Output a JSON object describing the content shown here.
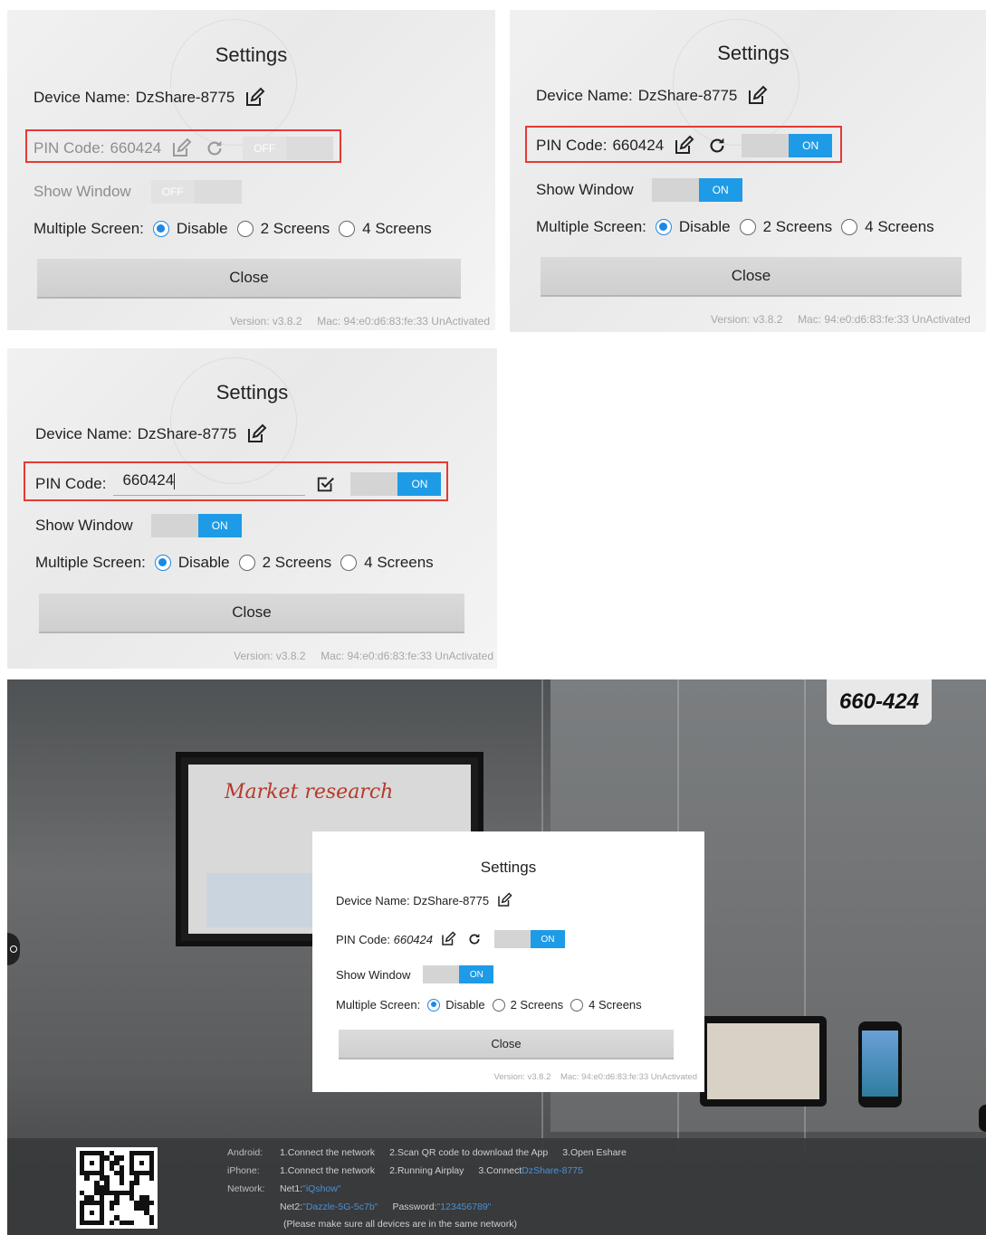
{
  "panels": [
    {
      "title": "Settings",
      "device_name_label": "Device Name:",
      "device_name_value": "DzShare-8775",
      "pin_label": "PIN Code:",
      "pin_value": "660424",
      "pin_toggle": "OFF",
      "show_window_label": "Show Window",
      "show_window_toggle": "OFF",
      "multiple_screen_label": "Multiple Screen:",
      "options": [
        "Disable",
        "2 Screens",
        "4 Screens"
      ],
      "selected": "Disable",
      "close_label": "Close",
      "version": "Version: v3.8.2",
      "mac": "Mac: 94:e0:d6:83:fe:33 UnActivated"
    },
    {
      "title": "Settings",
      "device_name_label": "Device Name:",
      "device_name_value": "DzShare-8775",
      "pin_label": "PIN Code:",
      "pin_value": "660424",
      "pin_toggle": "ON",
      "show_window_label": "Show Window",
      "show_window_toggle": "ON",
      "multiple_screen_label": "Multiple Screen:",
      "options": [
        "Disable",
        "2 Screens",
        "4 Screens"
      ],
      "selected": "Disable",
      "close_label": "Close",
      "version": "Version: v3.8.2",
      "mac": "Mac: 94:e0:d6:83:fe:33 UnActivated"
    },
    {
      "title": "Settings",
      "device_name_label": "Device Name:",
      "device_name_value": "DzShare-8775",
      "pin_label": "PIN Code:",
      "pin_value": "660424",
      "pin_toggle": "ON",
      "show_window_label": "Show Window",
      "show_window_toggle": "ON",
      "multiple_screen_label": "Multiple Screen:",
      "options": [
        "Disable",
        "2 Screens",
        "4 Screens"
      ],
      "selected": "Disable",
      "close_label": "Close",
      "version": "Version: v3.8.2",
      "mac": "Mac: 94:e0:d6:83:fe:33 UnActivated"
    }
  ],
  "fullscreen": {
    "pin_badge": "660-424",
    "board_handwriting": "Market research",
    "dialog": {
      "title": "Settings",
      "device_name_label": "Device Name:",
      "device_name_value": "DzShare-8775",
      "pin_label": "PIN Code:",
      "pin_value": "660424",
      "pin_toggle": "ON",
      "show_window_label": "Show Window",
      "show_window_toggle": "ON",
      "multiple_screen_label": "Multiple Screen:",
      "options": [
        "Disable",
        "2 Screens",
        "4 Screens"
      ],
      "selected": "Disable",
      "close_label": "Close",
      "version": "Version: v3.8.2",
      "mac": "Mac: 94:e0:d6:83:fe:33 UnActivated"
    },
    "info": {
      "android_label": "Android:",
      "android_steps": [
        "1.Connect the network",
        "2.Scan QR code to download the App",
        "3.Open Eshare"
      ],
      "iphone_label": "iPhone:",
      "iphone_steps": [
        "1.Connect the network",
        "2.Running Airplay",
        "3.Connect"
      ],
      "iphone_device": "DzShare-8775",
      "network_label": "Network:",
      "net1_label": "Net1:",
      "net1_value": "\"iQshow\"",
      "net2_label": "Net2:",
      "net2_value": "\"Dazzle-5G-5c7b\"",
      "password_label": "Password:",
      "password_value": "\"123456789\"",
      "note": "(Please make sure all devices are in the same network)"
    }
  },
  "colors": {
    "accent": "#1e9be6",
    "highlight_box": "#e53935",
    "link": "#4a90d9"
  },
  "icons": [
    "edit-icon",
    "refresh-icon",
    "checkbox-check-icon",
    "qr-code-icon"
  ]
}
